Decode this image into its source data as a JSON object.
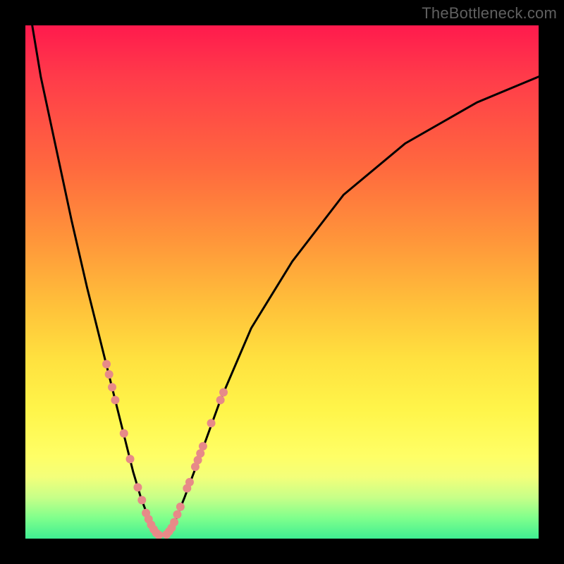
{
  "watermark": "TheBottleneck.com",
  "chart_data": {
    "type": "line",
    "title": "",
    "xlabel": "",
    "ylabel": "",
    "xlim": [
      0,
      100
    ],
    "ylim": [
      0,
      100
    ],
    "grid": false,
    "legend": "none",
    "series": [
      {
        "name": "left-curve",
        "x": [
          1,
          3,
          6,
          9,
          12,
          14,
          16,
          18,
          19.5,
          21,
          22.5,
          24,
          25.3,
          26
        ],
        "y": [
          102,
          90,
          76,
          62,
          49,
          41,
          33,
          25,
          19,
          13,
          8,
          4,
          1.2,
          0.5
        ]
      },
      {
        "name": "right-curve",
        "x": [
          27.5,
          29,
          31,
          34,
          38,
          44,
          52,
          62,
          74,
          88,
          100
        ],
        "y": [
          0.8,
          3,
          8,
          16,
          27,
          41,
          54,
          67,
          77,
          85,
          90
        ]
      }
    ],
    "markers": {
      "color": "#e78a88",
      "radius_px": 6,
      "points": [
        {
          "x": 15.8,
          "y": 34.0
        },
        {
          "x": 16.3,
          "y": 32.0
        },
        {
          "x": 16.9,
          "y": 29.5
        },
        {
          "x": 17.5,
          "y": 27.0
        },
        {
          "x": 19.2,
          "y": 20.5
        },
        {
          "x": 20.4,
          "y": 15.5
        },
        {
          "x": 21.9,
          "y": 10.0
        },
        {
          "x": 22.7,
          "y": 7.5
        },
        {
          "x": 23.5,
          "y": 5.0
        },
        {
          "x": 24.0,
          "y": 3.8
        },
        {
          "x": 24.5,
          "y": 2.7
        },
        {
          "x": 25.0,
          "y": 1.8
        },
        {
          "x": 25.5,
          "y": 1.1
        },
        {
          "x": 26.0,
          "y": 0.7
        },
        {
          "x": 27.5,
          "y": 0.8
        },
        {
          "x": 28.0,
          "y": 1.4
        },
        {
          "x": 28.5,
          "y": 2.1
        },
        {
          "x": 29.0,
          "y": 3.2
        },
        {
          "x": 29.6,
          "y": 4.7
        },
        {
          "x": 30.2,
          "y": 6.2
        },
        {
          "x": 31.5,
          "y": 9.8
        },
        {
          "x": 32.0,
          "y": 11.0
        },
        {
          "x": 33.1,
          "y": 14.0
        },
        {
          "x": 33.6,
          "y": 15.3
        },
        {
          "x": 34.1,
          "y": 16.6
        },
        {
          "x": 34.6,
          "y": 18.0
        },
        {
          "x": 36.2,
          "y": 22.5
        },
        {
          "x": 38.0,
          "y": 27.0
        },
        {
          "x": 38.6,
          "y": 28.5
        }
      ]
    }
  }
}
